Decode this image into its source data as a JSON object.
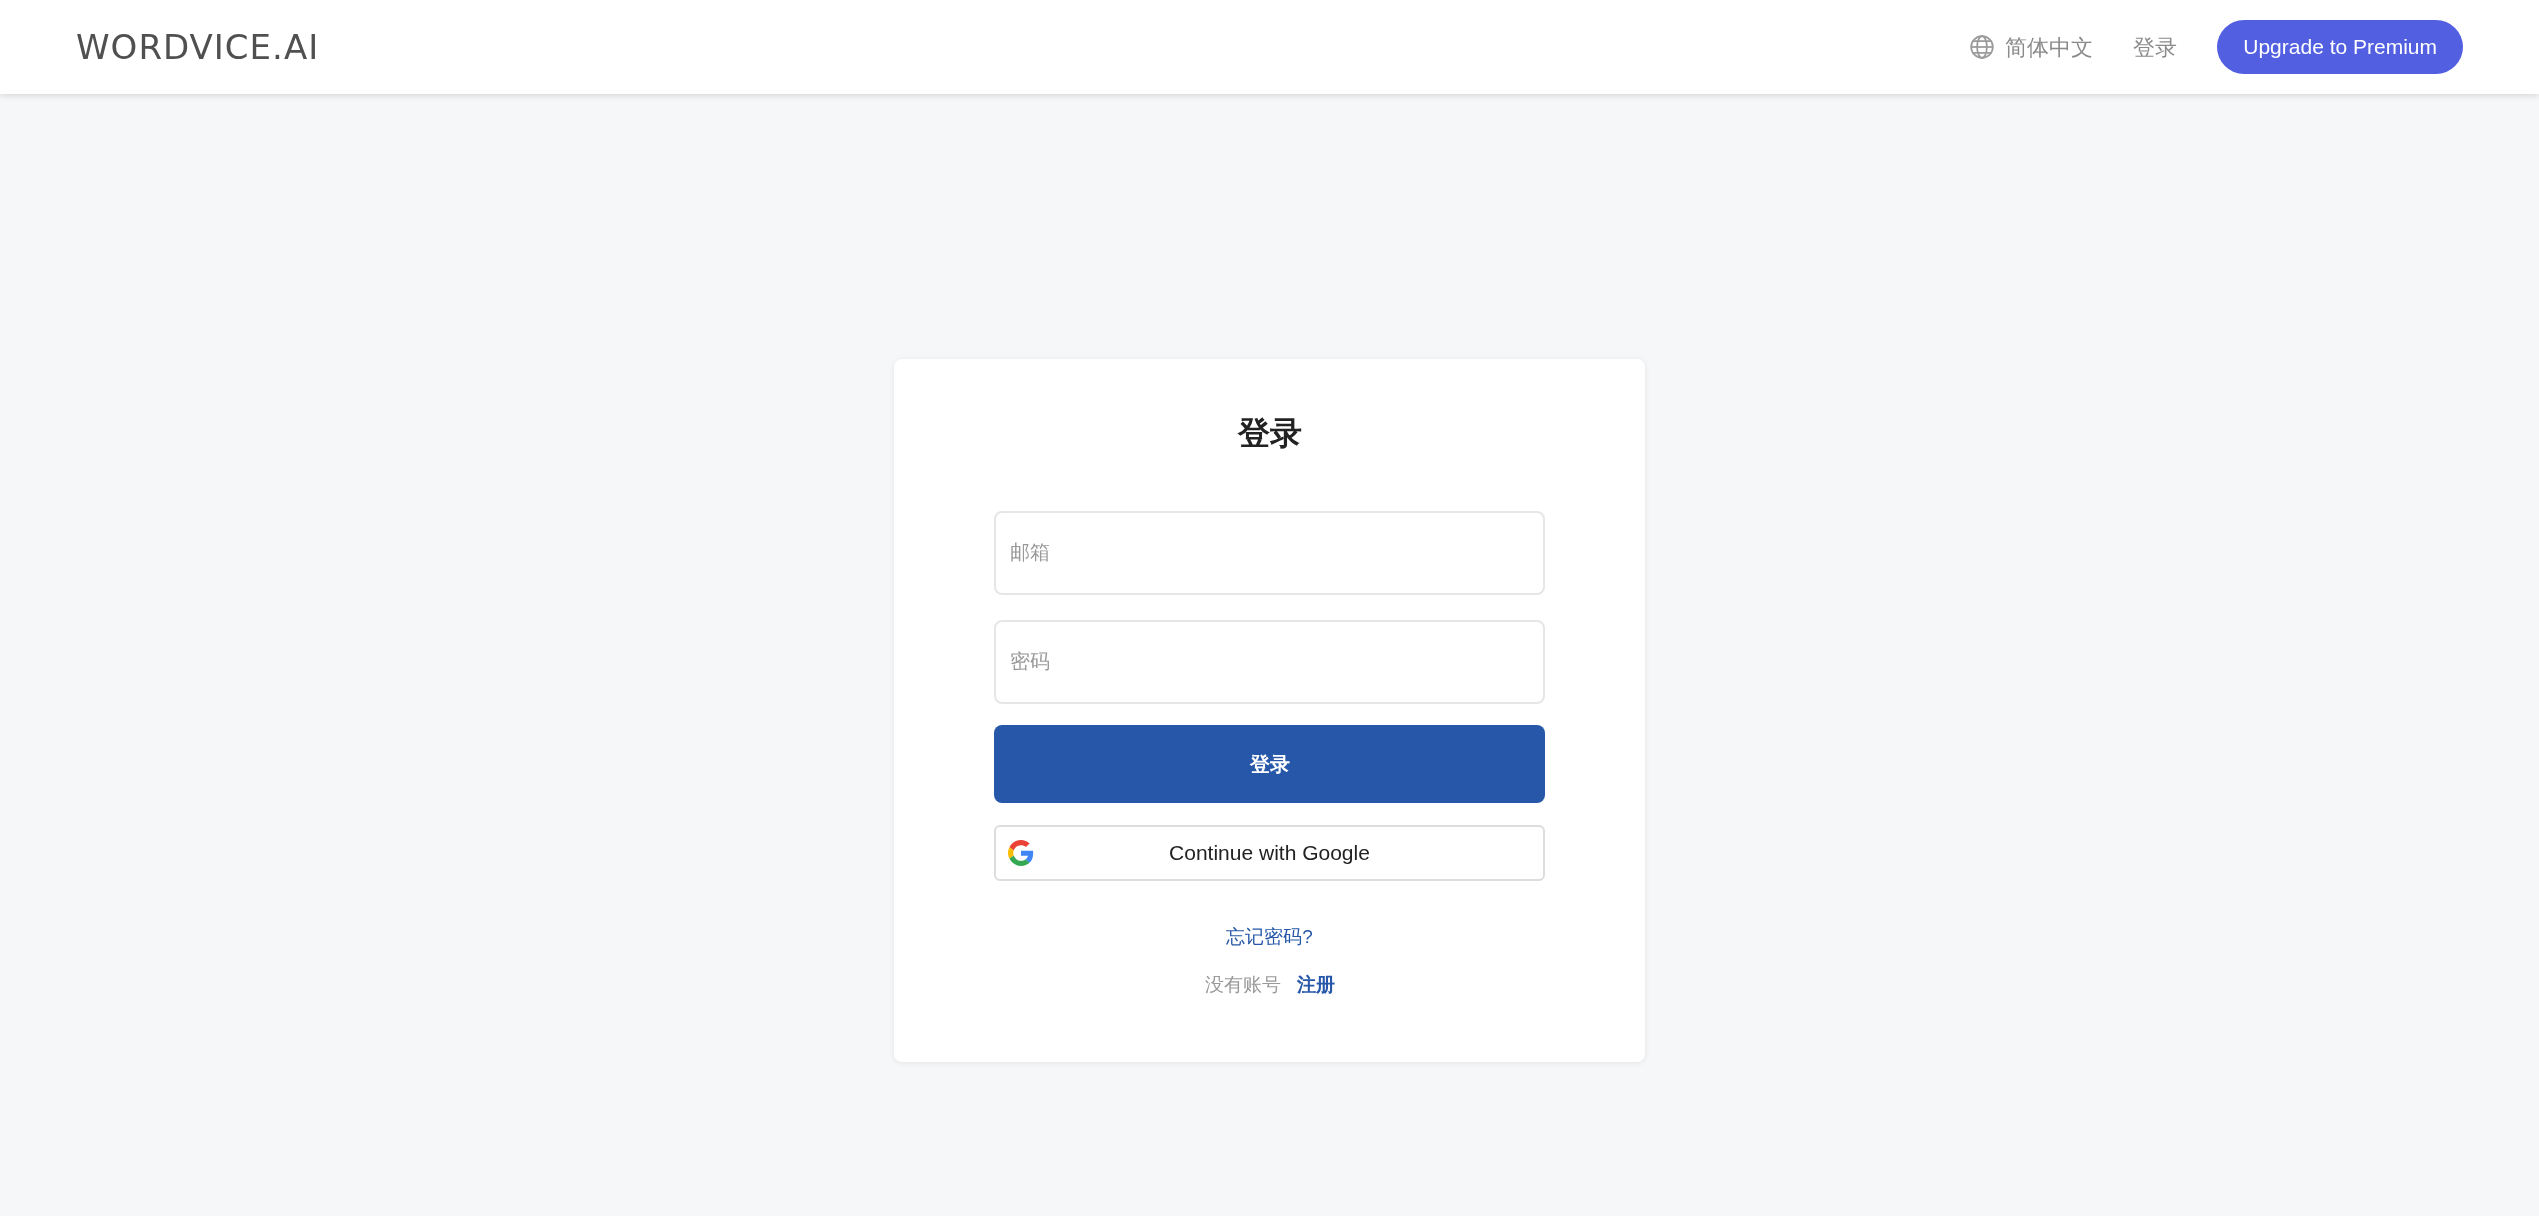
{
  "header": {
    "logo": "WORDVICE.AI",
    "language": "简体中文",
    "login_link": "登录",
    "upgrade_button": "Upgrade to Premium"
  },
  "login_card": {
    "title": "登录",
    "fields": [
      {
        "placeholder": "邮箱"
      },
      {
        "placeholder": "密码"
      }
    ],
    "submit_button": "登录",
    "google_button": "Continue with Google",
    "forgot_link": "忘记密码?",
    "no_account_text": "没有账号",
    "register_link": "注册"
  }
}
